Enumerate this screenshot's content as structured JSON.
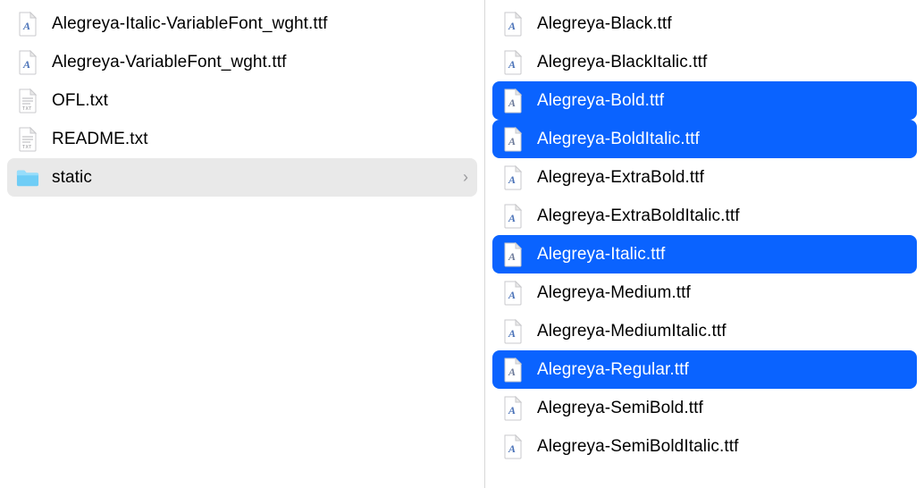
{
  "leftColumn": {
    "items": [
      {
        "type": "font",
        "name": "Alegreya-Italic-VariableFont_wght.ttf",
        "selected": false,
        "hasArrow": false
      },
      {
        "type": "font",
        "name": "Alegreya-VariableFont_wght.ttf",
        "selected": false,
        "hasArrow": false
      },
      {
        "type": "txt",
        "name": "OFL.txt",
        "selected": false,
        "hasArrow": false
      },
      {
        "type": "txt",
        "name": "README.txt",
        "selected": false,
        "hasArrow": false
      },
      {
        "type": "folder",
        "name": "static",
        "selected": false,
        "highlighted": true,
        "hasArrow": true
      }
    ]
  },
  "rightColumn": {
    "items": [
      {
        "type": "font",
        "name": "Alegreya-Black.ttf",
        "selected": false
      },
      {
        "type": "font",
        "name": "Alegreya-BlackItalic.ttf",
        "selected": false
      },
      {
        "type": "font",
        "name": "Alegreya-Bold.ttf",
        "selected": true
      },
      {
        "type": "font",
        "name": "Alegreya-BoldItalic.ttf",
        "selected": true
      },
      {
        "type": "font",
        "name": "Alegreya-ExtraBold.ttf",
        "selected": false
      },
      {
        "type": "font",
        "name": "Alegreya-ExtraBoldItalic.ttf",
        "selected": false
      },
      {
        "type": "font",
        "name": "Alegreya-Italic.ttf",
        "selected": true
      },
      {
        "type": "font",
        "name": "Alegreya-Medium.ttf",
        "selected": false
      },
      {
        "type": "font",
        "name": "Alegreya-MediumItalic.ttf",
        "selected": false
      },
      {
        "type": "font",
        "name": "Alegreya-Regular.ttf",
        "selected": true
      },
      {
        "type": "font",
        "name": "Alegreya-SemiBold.ttf",
        "selected": false
      },
      {
        "type": "font",
        "name": "Alegreya-SemiBoldItalic.ttf",
        "selected": false
      }
    ]
  },
  "icons": {
    "fontGlyph": "A",
    "txtLabel": "TXT"
  }
}
